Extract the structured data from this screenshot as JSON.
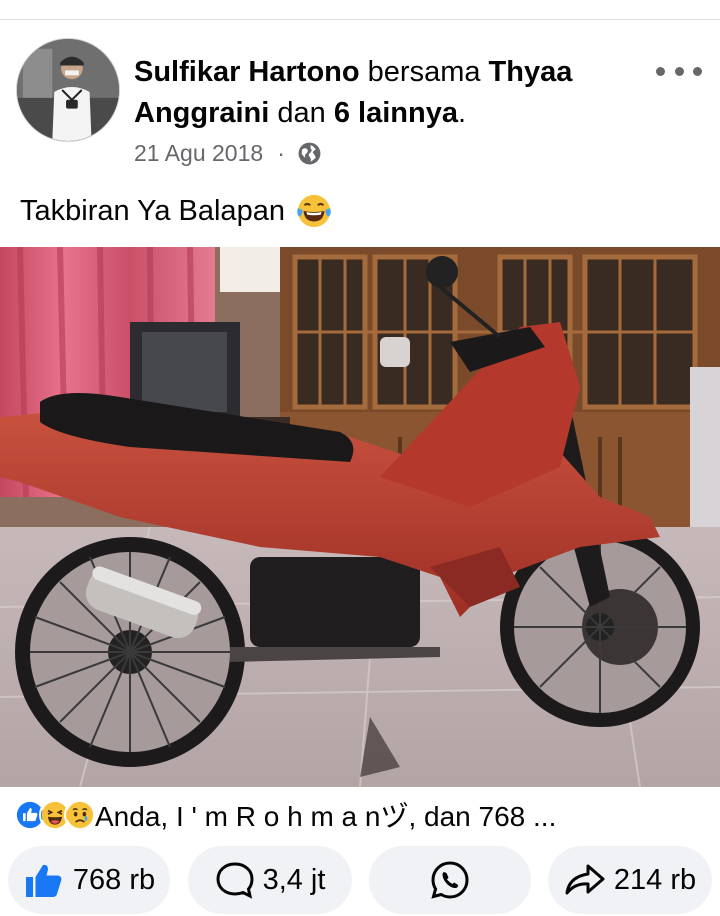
{
  "post": {
    "author": "Sulfikar Hartono",
    "with_word": "bersama",
    "tagged": "Thyaa Anggraini",
    "and_word": "dan",
    "others": "6 lainnya",
    "period": ".",
    "date": "21 Agu 2018",
    "separator": "·",
    "caption": "Takbiran Ya Balapan"
  },
  "reactions": {
    "summary": "Anda, I ' m R o h m a nヅ, dan 768 ...",
    "icons": [
      "like-icon",
      "laugh-icon",
      "sad-icon"
    ]
  },
  "actions": {
    "like_count": "768 rb",
    "comment_count": "3,4 jt",
    "share_count": "214 rb"
  },
  "colors": {
    "like_blue": "#1877f2",
    "secondary_text": "#65676b",
    "button_bg": "#f0f2f5",
    "whatsapp_icon": "#050505"
  }
}
